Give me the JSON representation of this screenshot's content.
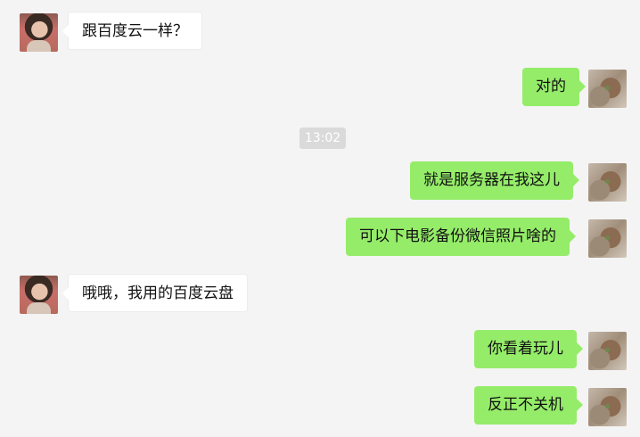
{
  "messages": [
    {
      "side": "left",
      "text": "跟百度云一样？"
    },
    {
      "side": "right",
      "text": "对的"
    },
    {
      "side": "right",
      "text": "就是服务器在我这儿"
    },
    {
      "side": "right",
      "text": "可以下电影备份微信照片啥的"
    },
    {
      "side": "left",
      "text": "哦哦，我用的百度云盘"
    },
    {
      "side": "right",
      "text": "你看着玩儿"
    },
    {
      "side": "right",
      "text": "反正不关机"
    }
  ],
  "timestamp": "13:02",
  "colors": {
    "sent_bubble": "#95ec69",
    "received_bubble": "#ffffff",
    "background": "#f4f4f4"
  },
  "icons": {
    "contact_avatar": "contact-avatar-icon",
    "user_avatar": "user-avatar-icon"
  }
}
